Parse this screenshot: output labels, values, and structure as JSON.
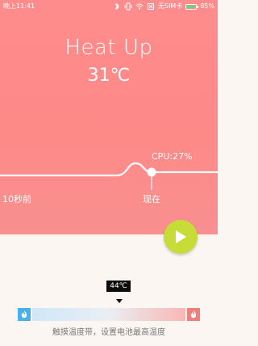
{
  "status_bar": {
    "time": "晚上11:41",
    "carrier": "无SIM卡",
    "battery": "85%",
    "battery_level": 0.85,
    "icons": [
      "bluetooth-icon",
      "vibrate-icon",
      "wifi-icon",
      "sim-icon",
      "battery-icon"
    ]
  },
  "hero": {
    "title": "Heat Up",
    "temperature": "31℃",
    "cpu_label": "CPU:27%",
    "time_left": "10秒前",
    "time_now": "现在"
  },
  "controls": {
    "play_icon": "play-icon"
  },
  "threshold": {
    "value_label": "44℃",
    "hint": "触摸温度带，设置电池最高温度"
  },
  "colors": {
    "hero_background": "#fd8a87",
    "play_button": "#c8dc37",
    "cold": "#47b1ee",
    "hot": "#f0807c"
  }
}
